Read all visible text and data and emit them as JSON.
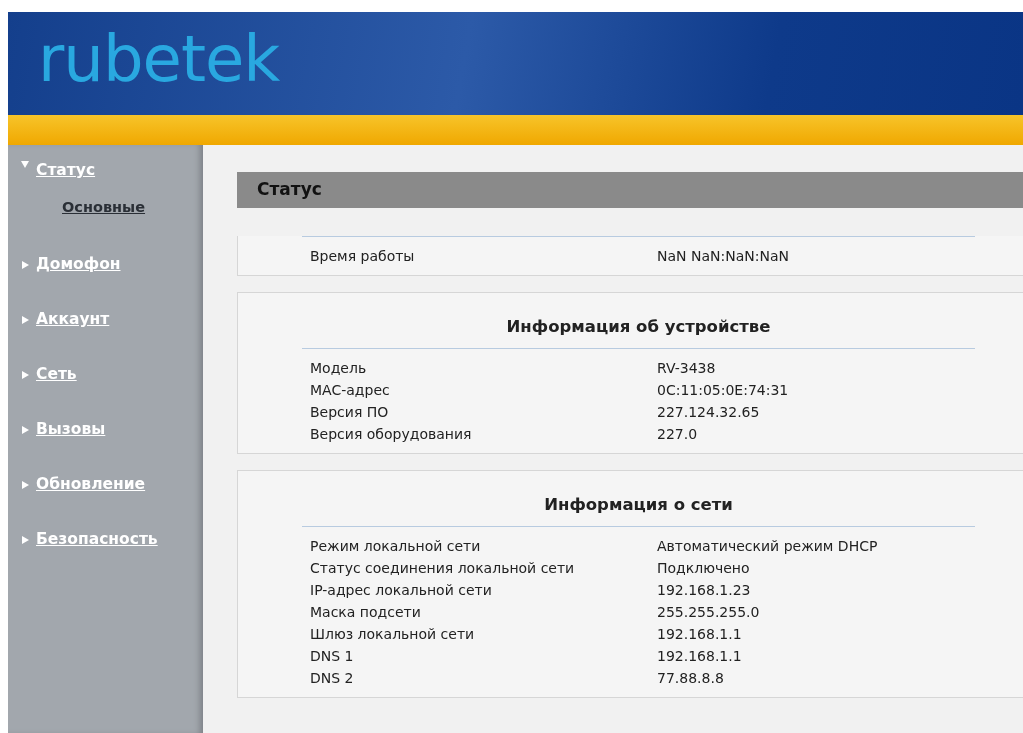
{
  "header": {
    "logo": "rubetek"
  },
  "sidebar": {
    "items": [
      {
        "label": "Статус",
        "expanded": true,
        "children": [
          {
            "label": "Основные",
            "selected": true
          }
        ]
      },
      {
        "label": "Домофон",
        "expanded": false
      },
      {
        "label": "Аккаунт",
        "expanded": false
      },
      {
        "label": "Сеть",
        "expanded": false
      },
      {
        "label": "Вызовы",
        "expanded": false
      },
      {
        "label": "Обновление",
        "expanded": false
      },
      {
        "label": "Безопасность",
        "expanded": false
      }
    ]
  },
  "page_title": "Статус",
  "panels": [
    {
      "rows": [
        {
          "label": "Время работы",
          "value": "NaN NaN:NaN:NaN"
        }
      ]
    },
    {
      "title": "Информация об устройстве",
      "rows": [
        {
          "label": "Модель",
          "value": "RV-3438"
        },
        {
          "label": "MAC-адрес",
          "value": "0C:11:05:0E:74:31"
        },
        {
          "label": "Версия ПО",
          "value": "227.124.32.65"
        },
        {
          "label": "Версия оборудования",
          "value": "227.0"
        }
      ]
    },
    {
      "title": "Информация о сети",
      "rows": [
        {
          "label": "Режим локальной сети",
          "value": "Автоматический режим DHCP"
        },
        {
          "label": "Статус соединения локальной сети",
          "value": "Подключено"
        },
        {
          "label": "IP-адрес локальной сети",
          "value": "192.168.1.23"
        },
        {
          "label": "Маска подсети",
          "value": "255.255.255.0"
        },
        {
          "label": "Шлюз локальной сети",
          "value": "192.168.1.1"
        },
        {
          "label": "DNS 1",
          "value": "192.168.1.1"
        },
        {
          "label": "DNS 2",
          "value": "77.88.8.8"
        }
      ]
    }
  ]
}
